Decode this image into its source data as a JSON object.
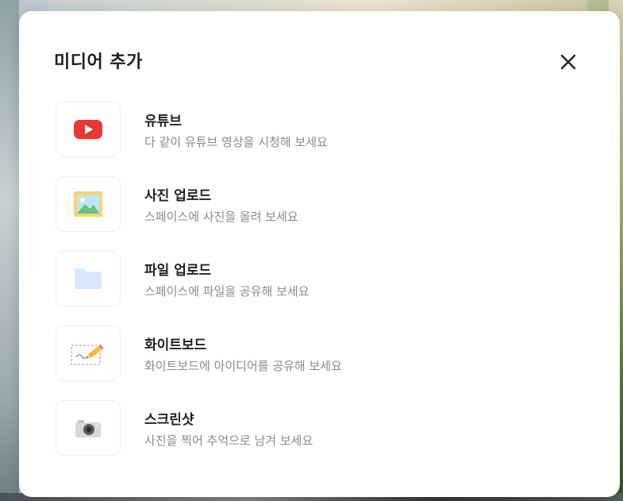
{
  "modal": {
    "title": "미디어 추가",
    "close_symbol": "✕"
  },
  "items": [
    {
      "icon": "youtube-icon",
      "title": "유튜브",
      "description": "다 같이 유튜브 영상을 시청해 보세요"
    },
    {
      "icon": "image-icon",
      "title": "사진 업로드",
      "description": "스페이스에 사진을 올려 보세요"
    },
    {
      "icon": "folder-icon",
      "title": "파일 업로드",
      "description": "스페이스에 파일을 공유해 보세요"
    },
    {
      "icon": "whiteboard-pencil-icon",
      "title": "화이트보드",
      "description": "화이트보드에 아이디어를 공유해 보세요"
    },
    {
      "icon": "camera-icon",
      "title": "스크린샷",
      "description": "사진을 찍어 추억으로 남겨 보세요"
    }
  ],
  "colors": {
    "youtube_red": "#e53935",
    "folder_blue": "#dbe7fb",
    "image_frame": "#f3d57a",
    "image_sky": "#bfe5f4",
    "image_hill": "#6cbf7a"
  }
}
